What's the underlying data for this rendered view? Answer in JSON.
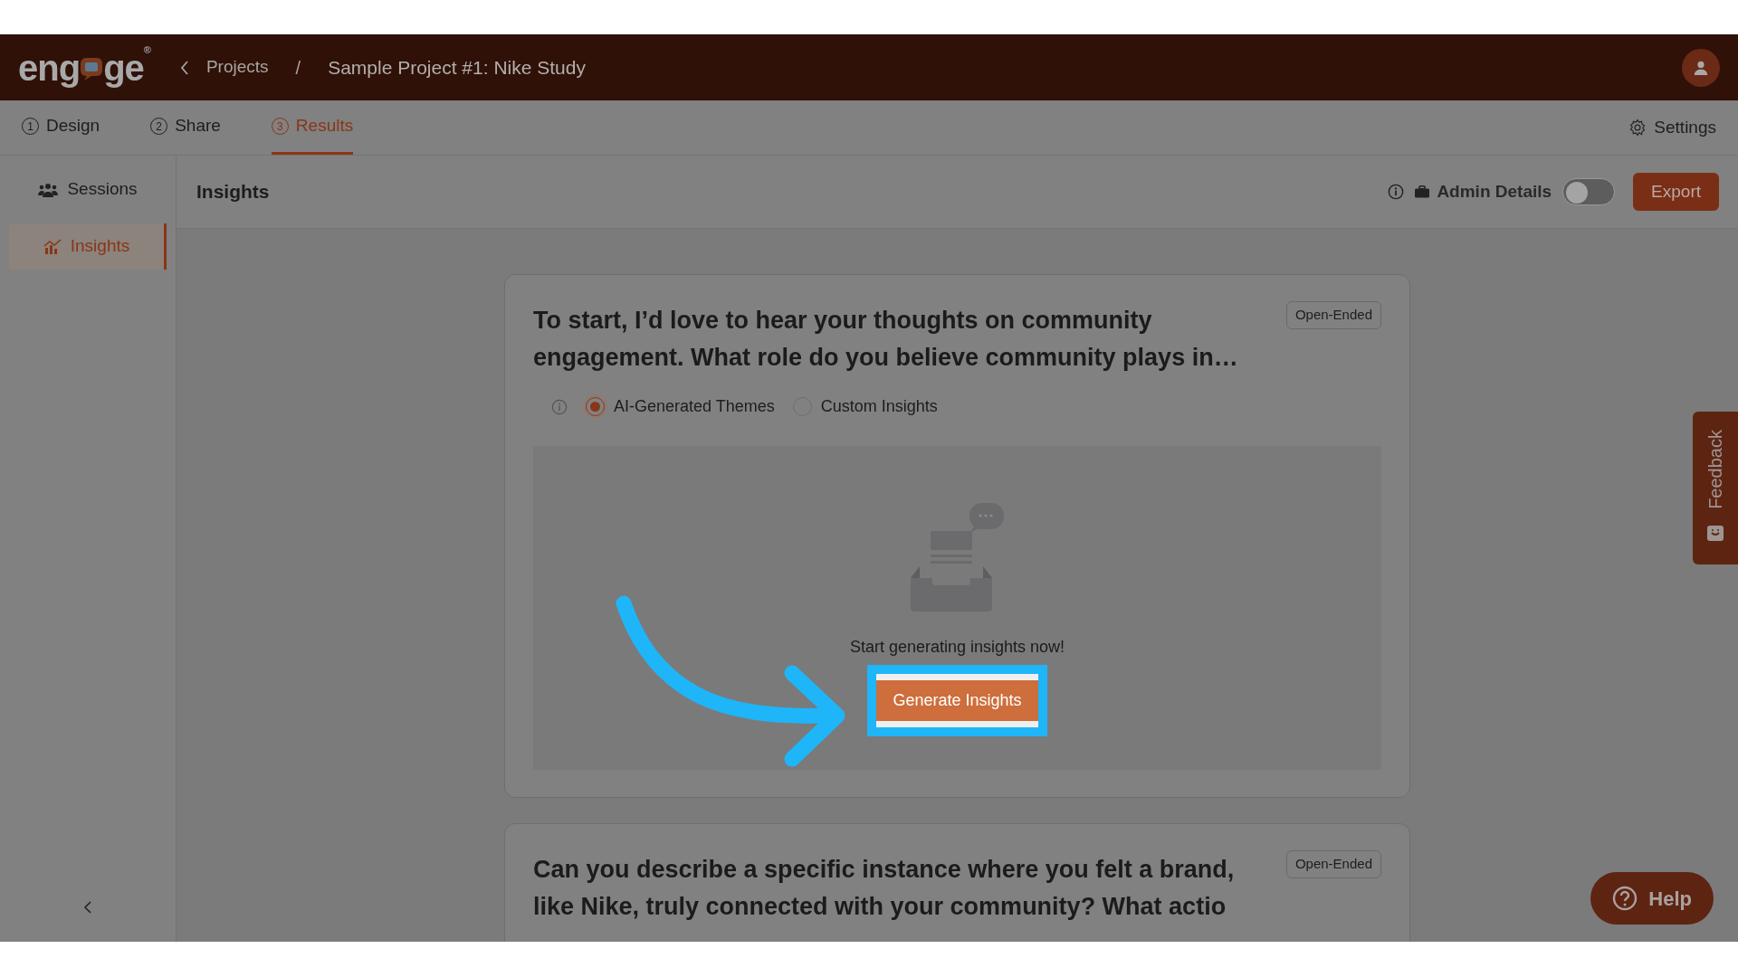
{
  "header": {
    "logo": {
      "parts": [
        "eng",
        "ge"
      ],
      "mark": "®"
    },
    "breadcrumb": {
      "parent": "Projects",
      "separator": "/",
      "current": "Sample Project #1: Nike Study"
    }
  },
  "tabs": [
    {
      "number": "1",
      "label": "Design",
      "selected": false
    },
    {
      "number": "2",
      "label": "Share",
      "selected": false
    },
    {
      "number": "3",
      "label": "Results",
      "selected": true
    }
  ],
  "settings": "Settings",
  "sidebar": {
    "items": [
      {
        "kind": "sessions",
        "label": "Sessions",
        "selected": false
      },
      {
        "kind": "insights",
        "label": "Insights",
        "selected": true
      }
    ]
  },
  "toolbar": {
    "title": "Insights",
    "admin_details": {
      "label": "Admin Details",
      "on": false
    },
    "export": "Export"
  },
  "questions": [
    {
      "text": "To start, I’d love to hear your thoughts on community engagement. What role do you believe community plays in…",
      "badge": "Open-Ended",
      "modes": [
        {
          "label": "AI-Generated Themes",
          "selected": true
        },
        {
          "label": "Custom Insights",
          "selected": false
        }
      ],
      "empty_state": {
        "message": "Start generating insights now!",
        "button": "Generate Insights"
      }
    },
    {
      "text": "Can you describe a specific instance where you felt a brand, like Nike, truly connected with your community? What actio",
      "badge": "Open-Ended"
    }
  ],
  "feedback": "Feedback",
  "help": "Help"
}
